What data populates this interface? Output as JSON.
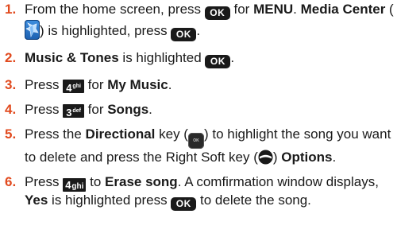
{
  "steps": [
    {
      "num": "1.",
      "t1": "From the home screen, press ",
      "t2": " for ",
      "b1": "MENU",
      "t3": ". ",
      "b2": "Media Center",
      "t4": " (",
      "t5": ") is highlighted, press ",
      "t6": "."
    },
    {
      "num": "2.",
      "b1": "Music & Tones",
      "t1": " is highlighted ",
      "t2": "."
    },
    {
      "num": "3.",
      "t1": "Press ",
      "t2": " for ",
      "b1": "My Music",
      "t3": "."
    },
    {
      "num": "4.",
      "t1": "Press ",
      "t2": " for ",
      "b1": "Songs",
      "t3": "."
    },
    {
      "num": "5.",
      "t1": "Press the ",
      "b1": "Directional",
      "t2": " key (",
      "t3": ") to highlight the song you want to delete and press the Right Soft key (",
      "t4": ") ",
      "b2": "Options",
      "t5": "."
    },
    {
      "num": "6.",
      "t1": "Press ",
      "t2": " to ",
      "b1": "Erase song",
      "t3": ". A comfirmation window displays, ",
      "b2": "Yes",
      "t4": " is highlighted press ",
      "t5": " to delete the song."
    }
  ],
  "keys": {
    "ok": "OK",
    "four": "4",
    "four_letters": "ghi",
    "three": "3",
    "three_letters": "def",
    "dir_label": "OK"
  },
  "icons": {
    "ok_key": "ok-key-icon",
    "media_center": "media-center-icon",
    "directional_key": "directional-key-icon",
    "right_soft_key": "right-soft-key-icon"
  },
  "colors": {
    "step_number": "#e14a1e",
    "key_background": "#1a1a1a",
    "media_center_blue": "#2a78d0"
  }
}
